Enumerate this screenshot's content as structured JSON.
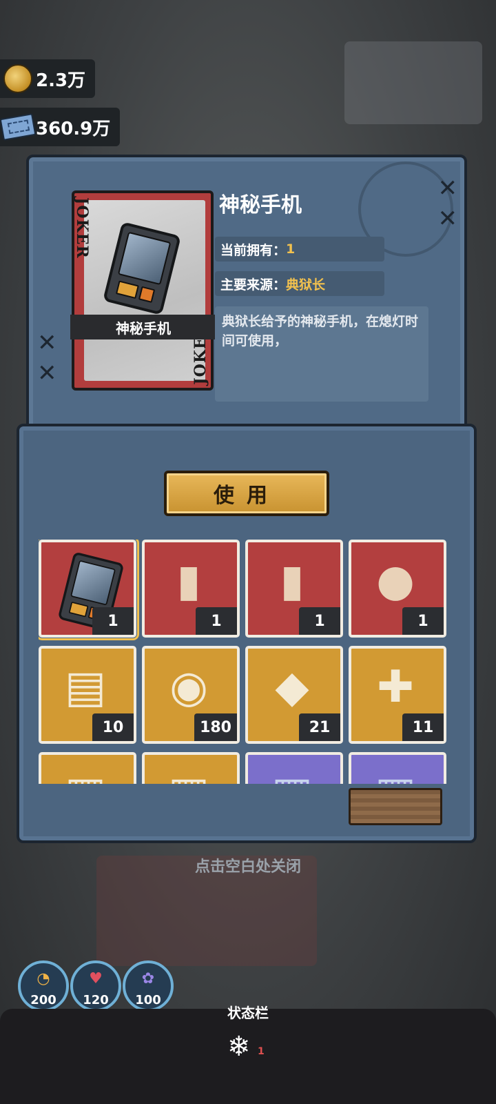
{
  "currency": {
    "coins": "2.3万",
    "tickets": "360.9万",
    "coin_icon": "coin-icon",
    "ticket_icon": "ticket-icon"
  },
  "detail": {
    "card_top_text": "JOKER",
    "card_bottom_text": "JOKER",
    "card_name": "神秘手机",
    "title": "神秘手机",
    "owned_label": "当前拥有：",
    "owned_value": "1",
    "source_label": "主要来源：",
    "source_value": "典狱长",
    "description": "典狱长给予的神秘手机，在熄灯时间可使用，"
  },
  "use_button": "使用",
  "inventory": [
    {
      "icon": "phone-icon",
      "count": "1",
      "color": "red",
      "selected": true
    },
    {
      "icon": "usb-drive-orange-icon",
      "count": "1",
      "color": "red"
    },
    {
      "icon": "usb-drive-grey-icon",
      "count": "1",
      "color": "red"
    },
    {
      "icon": "walnut-icon",
      "count": "1",
      "color": "red"
    },
    {
      "icon": "map-scroll-icon",
      "count": "10",
      "color": "gold"
    },
    {
      "icon": "film-reel-icon",
      "count": "180",
      "color": "gold"
    },
    {
      "icon": "badge-card-icon",
      "count": "21",
      "color": "gold"
    },
    {
      "icon": "medical-card-icon",
      "count": "11",
      "color": "gold"
    },
    {
      "icon": "item-icon",
      "count": "",
      "color": "gold"
    },
    {
      "icon": "item-icon",
      "count": "",
      "color": "gold"
    },
    {
      "icon": "item-icon",
      "count": "",
      "color": "purple"
    },
    {
      "icon": "item-icon",
      "count": "",
      "color": "purple"
    }
  ],
  "close_hint": "点击空白处关闭",
  "stats": [
    {
      "icon": "hunger-icon",
      "value": "200"
    },
    {
      "icon": "heart-icon",
      "value": "120"
    },
    {
      "icon": "brain-icon",
      "value": "100"
    }
  ],
  "status_bar": {
    "label": "状态栏",
    "icon": "snowflake-icon",
    "count": "1"
  }
}
